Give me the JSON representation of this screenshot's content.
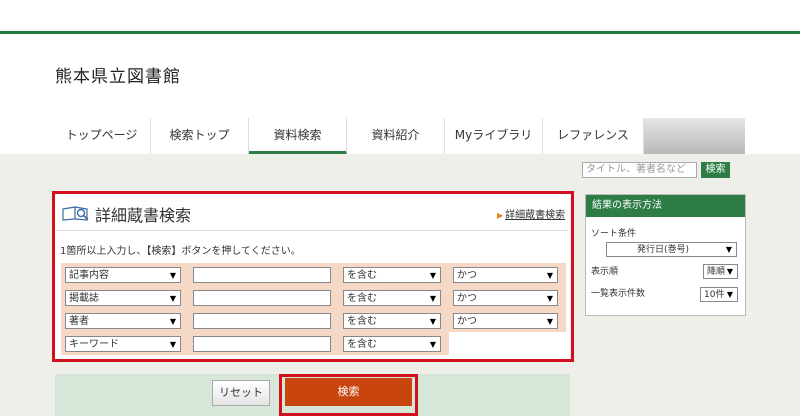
{
  "library": {
    "title": "熊本県立図書館"
  },
  "nav": {
    "items": [
      {
        "label": "トップページ"
      },
      {
        "label": "検索トップ"
      },
      {
        "label": "資料検索"
      },
      {
        "label": "資料紹介"
      },
      {
        "label": "Myライブラリ"
      },
      {
        "label": "レファレンス"
      }
    ],
    "active": "資料検索"
  },
  "quick_search": {
    "placeholder": "タイトル、著者名など",
    "button": "検索"
  },
  "panel": {
    "title": "詳細蔵書検索",
    "link": "詳細蔵書検索",
    "instruction": "1箇所以上入力し、【検索】ボタンを押してください。",
    "rows": [
      {
        "field": "記事内容",
        "value": "",
        "match": "を含む",
        "logic": "かつ"
      },
      {
        "field": "掲載誌",
        "value": "",
        "match": "を含む",
        "logic": "かつ"
      },
      {
        "field": "著者",
        "value": "",
        "match": "を含む",
        "logic": "かつ"
      },
      {
        "field": "キーワード",
        "value": "",
        "match": "を含む"
      }
    ],
    "reset": "リセット",
    "search": "検索"
  },
  "sidebar": {
    "title": "結果の表示方法",
    "sort_label": "ソート条件",
    "sort_value": "発行日(巻号)",
    "order_label": "表示順",
    "order_value": "降順",
    "count_label": "一覧表示件数",
    "count_value": "10件"
  },
  "colors": {
    "accent": "#2e7d47",
    "highlight": "#d3111e",
    "search_button": "#c9450e"
  }
}
